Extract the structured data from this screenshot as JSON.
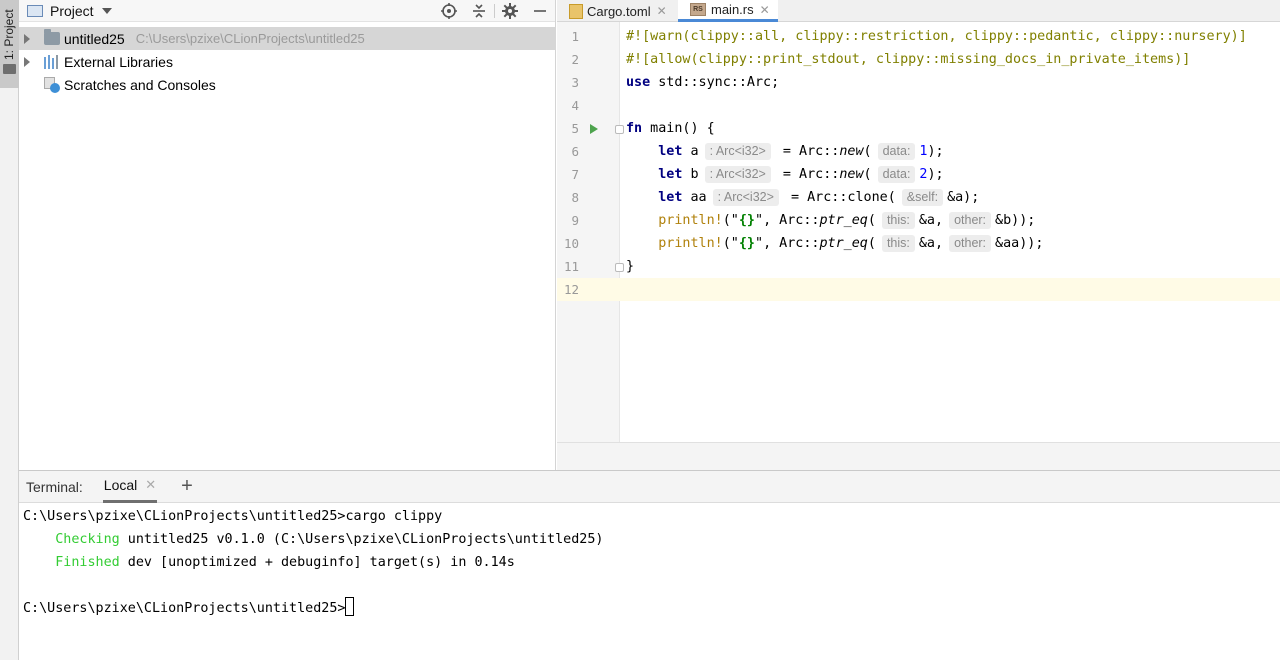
{
  "toolstrip": {
    "project_tab": "1: Project"
  },
  "project": {
    "title": "Project",
    "tree": [
      {
        "name": "untitled25",
        "path": "C:\\Users\\pzixe\\CLionProjects\\untitled25"
      },
      {
        "name": "External Libraries"
      },
      {
        "name": "Scratches and Consoles"
      }
    ]
  },
  "editor": {
    "tabs": [
      {
        "label": "Cargo.toml"
      },
      {
        "label": "main.rs"
      }
    ],
    "rs_icon_text": "RS",
    "line_numbers": [
      "1",
      "2",
      "3",
      "4",
      "5",
      "6",
      "7",
      "8",
      "9",
      "10",
      "11",
      "12"
    ],
    "lines": {
      "l1": "#![warn(clippy::all, clippy::restriction, clippy::pedantic, clippy::nursery)]",
      "l2": "#![allow(clippy::print_stdout, clippy::missing_docs_in_private_items)]",
      "l3_kw": "use",
      "l3_rest": " std::sync::Arc;",
      "l5_kw": "fn",
      "l5_rest": " main() {",
      "let": "let",
      "var_a": " a",
      "var_b": " b",
      "var_aa": " aa",
      "type_hint": ": Arc<i32>",
      "assign_new": " = Arc::",
      "new_fn": "new",
      "paren_open": "(",
      "hint_data": "data:",
      "num1": "1",
      "num2": "2",
      "close_semi": ");",
      "clone_call": " = Arc::clone(",
      "hint_self": "&self:",
      "ref_a_end": "&a);",
      "println": "println!",
      "str_open": "(\"",
      "str_braces": "{}",
      "str_close": "\"",
      "comma_arc": ", Arc::",
      "ptr_eq": "ptr_eq",
      "hint_this": "this:",
      "ref_a": "&a,",
      "hint_other": "other:",
      "ref_b_end": "&b));",
      "ref_aa_end": "&aa));",
      "close_brace": "}"
    }
  },
  "terminal": {
    "title": "Terminal:",
    "tab": "Local",
    "lines": {
      "cmd1": "C:\\Users\\pzixe\\CLionProjects\\untitled25>cargo clippy",
      "checking_word": "Checking",
      "checking_rest": " untitled25 v0.1.0 (C:\\Users\\pzixe\\CLionProjects\\untitled25)",
      "finished_word": "Finished",
      "finished_rest": " dev [unoptimized + debuginfo] target(s) in 0.14s",
      "prompt": "C:\\Users\\pzixe\\CLionProjects\\untitled25>"
    }
  },
  "colors": {
    "accent": "#4a89d6",
    "run_green": "#4da34d",
    "terminal_green": "#33cc33"
  }
}
